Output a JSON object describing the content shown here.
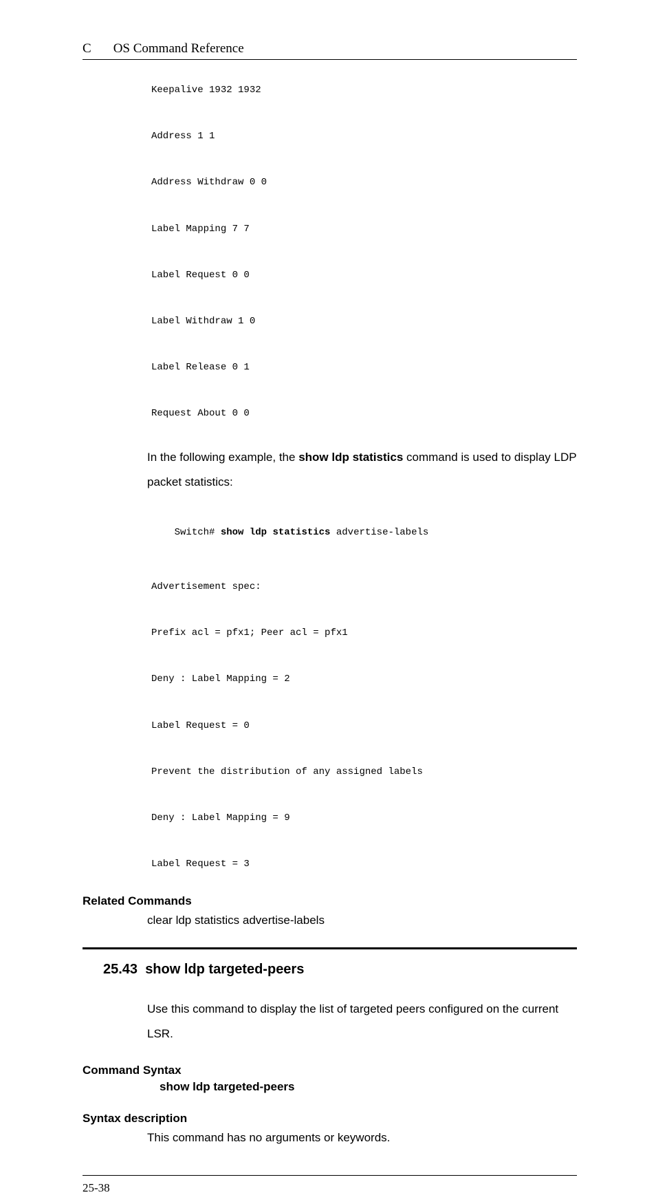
{
  "header": {
    "chapter_letter": "C",
    "chapter_title": "OS Command Reference"
  },
  "mono1": "Keepalive 1932 1932\n\nAddress 1 1\n\nAddress Withdraw 0 0\n\nLabel Mapping 7 7\n\nLabel Request 0 0\n\nLabel Withdraw 1 0\n\nLabel Release 0 1\n\nRequest About 0 0",
  "para1_pre": "In the following example, the ",
  "para1_bold": "show ldp statistics",
  "para1_post": " command is used to display LDP packet statistics:",
  "cmd_prompt": "Switch# ",
  "cmd_bold": "show ldp statistics ",
  "cmd_arg": "advertise-labels",
  "mono2": "Advertisement spec:\n\nPrefix acl = pfx1; Peer acl = pfx1\n\nDeny : Label Mapping = 2\n\nLabel Request = 0\n\nPrevent the distribution of any assigned labels\n\nDeny : Label Mapping = 9\n\nLabel Request = 3",
  "related_heading": "Related Commands",
  "related_body": "clear ldp statistics advertise-labels",
  "section": {
    "number": "25.43",
    "title": "show ldp targeted-peers"
  },
  "section_desc": "Use this command to display the list of targeted peers configured on the current LSR.",
  "syntax_heading": "Command Syntax",
  "syntax_text": "show ldp targeted-peers",
  "syntax_desc_heading": "Syntax description",
  "syntax_desc_body": "This command has no arguments or keywords.",
  "footer": {
    "page": "25-38"
  }
}
